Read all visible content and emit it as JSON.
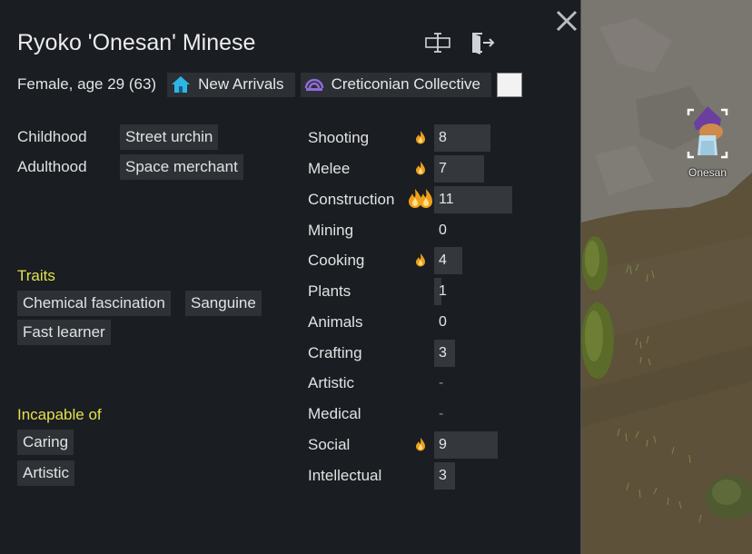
{
  "pawn": {
    "name": "Ryoko 'Onesan' Minese",
    "gender_age": "Female, age 29 (63)",
    "ideo_label": "New Arrivals",
    "faction_label": "Creticonian Collective",
    "faction_color": "#f2f2f2",
    "map_label": "Onesan"
  },
  "icons": {
    "rename": "rename-icon",
    "banish": "banish-icon",
    "close": "close-icon",
    "ideo": "house-icon",
    "faction": "faction-icon",
    "passion_minor": "flame-icon",
    "passion_major": "double-flame-icon"
  },
  "backstory": {
    "childhood_label": "Childhood",
    "childhood_value": "Street urchin",
    "adulthood_label": "Adulthood",
    "adulthood_value": "Space merchant"
  },
  "traits": {
    "title": "Traits",
    "items": [
      "Chemical fascination",
      "Sanguine",
      "Fast learner"
    ]
  },
  "incapable": {
    "title": "Incapable of",
    "items": [
      "Caring",
      "Artistic"
    ]
  },
  "skills": [
    {
      "name": "Shooting",
      "value": "8",
      "level": 8,
      "passion": "minor"
    },
    {
      "name": "Melee",
      "value": "7",
      "level": 7,
      "passion": "minor"
    },
    {
      "name": "Construction",
      "value": "11",
      "level": 11,
      "passion": "major"
    },
    {
      "name": "Mining",
      "value": "0",
      "level": 0,
      "passion": "none"
    },
    {
      "name": "Cooking",
      "value": "4",
      "level": 4,
      "passion": "minor"
    },
    {
      "name": "Plants",
      "value": "1",
      "level": 1,
      "passion": "none"
    },
    {
      "name": "Animals",
      "value": "0",
      "level": 0,
      "passion": "none"
    },
    {
      "name": "Crafting",
      "value": "3",
      "level": 3,
      "passion": "none"
    },
    {
      "name": "Artistic",
      "value": "-",
      "level": 0,
      "passion": "none"
    },
    {
      "name": "Medical",
      "value": "-",
      "level": 0,
      "passion": "none"
    },
    {
      "name": "Social",
      "value": "9",
      "level": 9,
      "passion": "minor"
    },
    {
      "name": "Intellectual",
      "value": "3",
      "level": 3,
      "passion": "none"
    }
  ],
  "colors": {
    "panel_bg": "#1a1d22",
    "section_title": "#e2e14c",
    "tag_bg": "#2e3136",
    "flame": "#f0a018"
  }
}
